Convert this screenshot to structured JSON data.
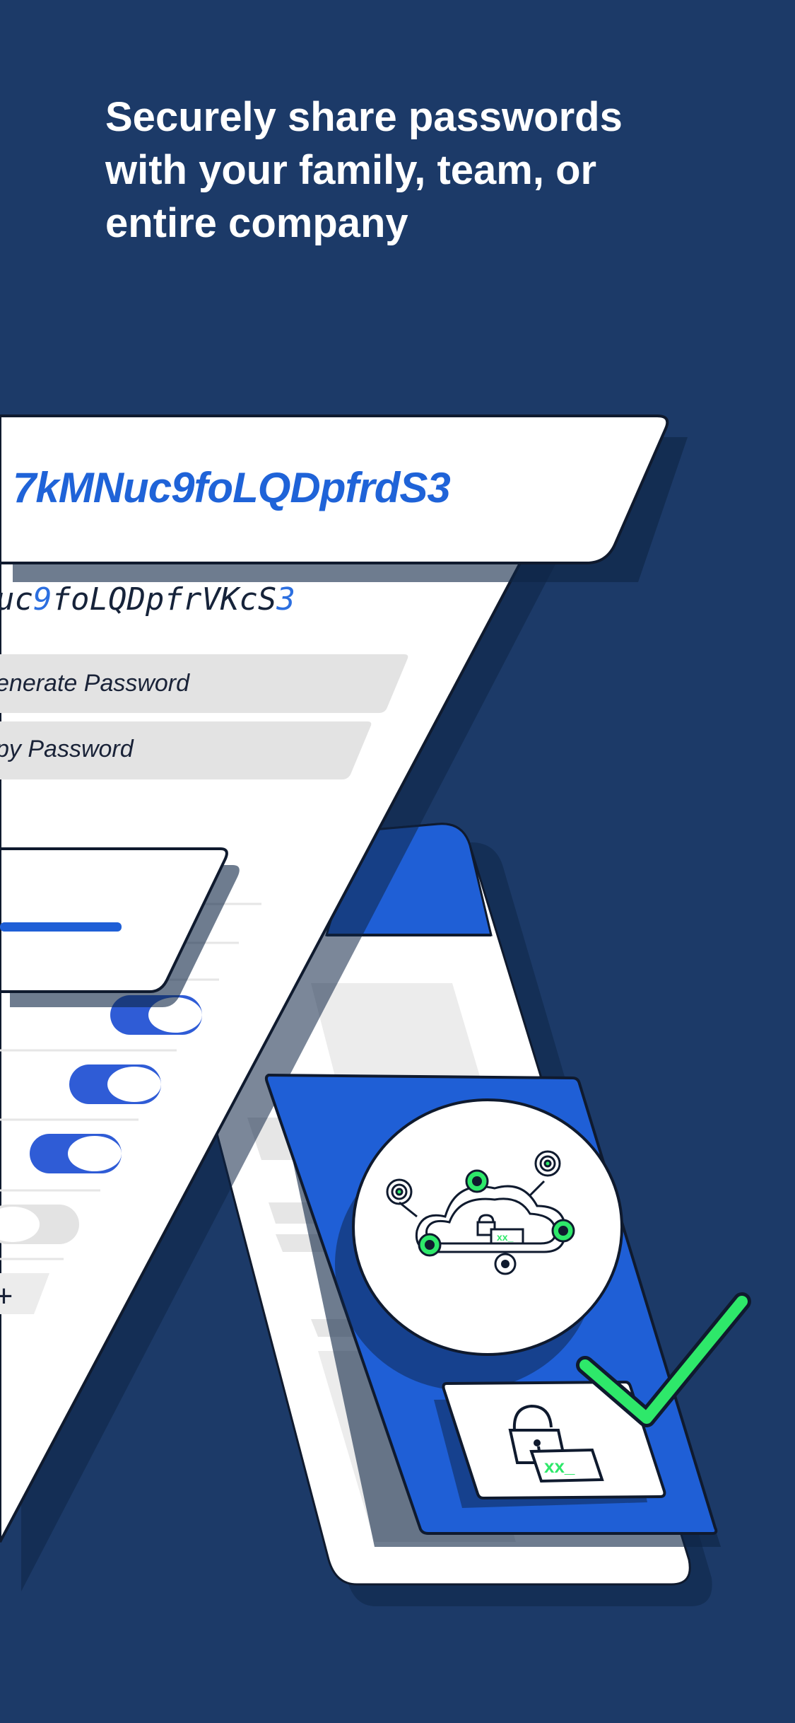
{
  "headline": {
    "line1": "Securely share passwords",
    "line2": "with your family, team, or",
    "line3": "entire company"
  },
  "generator": {
    "password_big": "7kMNuc9foLQDpfrdS3",
    "password_mono_a": "uc",
    "password_mono_b": "9",
    "password_mono_c": "foLQDpfrVKcS",
    "password_mono_d": "3",
    "generate_label": "enerate Password",
    "copy_label": "py Password",
    "plus_glyph": "+",
    "toggles": [
      true,
      true,
      true,
      false
    ]
  },
  "vault_card": {
    "key_chip_a": "xx_",
    "key_chip_b": "xx_"
  },
  "colors": {
    "background": "#1c3a68",
    "accent_blue": "#1f5fd6",
    "check_green": "#2ee86a",
    "card_white": "#ffffff",
    "outline_dark": "#0f1a2e"
  },
  "icons": [
    "cloud-icon",
    "lock-icon",
    "checkmark-icon",
    "toggle-icon"
  ]
}
